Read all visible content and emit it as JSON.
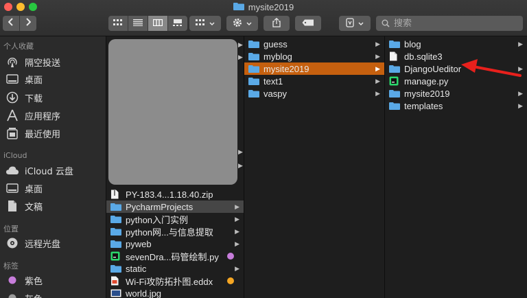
{
  "window": {
    "title": "mysite2019"
  },
  "toolbar": {
    "back_icon": "chevron-left-icon",
    "forward_icon": "chevron-right-icon",
    "view_icons": [
      "icon-view",
      "list-view",
      "column-view",
      "gallery-view"
    ],
    "group_icon": "group-grid-icon",
    "action_icon": "gear-icon",
    "share_icon": "share-icon",
    "tag_icon": "tag-icon",
    "extra_icon": "app-icon",
    "search_placeholder": "搜索"
  },
  "sidebar": {
    "sections": [
      {
        "label": "个人收藏",
        "items": [
          {
            "label": "隔空投送",
            "icon": "airdrop-icon"
          },
          {
            "label": "桌面",
            "icon": "desktop-icon"
          },
          {
            "label": "下载",
            "icon": "download-icon"
          },
          {
            "label": "应用程序",
            "icon": "applications-icon"
          },
          {
            "label": "最近使用",
            "icon": "recents-icon"
          }
        ]
      },
      {
        "label": "iCloud",
        "items": [
          {
            "label": "iCloud 云盘",
            "icon": "cloud-icon"
          },
          {
            "label": "桌面",
            "icon": "desktop-icon"
          },
          {
            "label": "文稿",
            "icon": "document-icon"
          }
        ]
      },
      {
        "label": "位置",
        "items": [
          {
            "label": "远程光盘",
            "icon": "disc-icon"
          }
        ]
      },
      {
        "label": "标签",
        "items": [
          {
            "label": "紫色",
            "icon": "tag-dot-icon",
            "color": "#c77ddb"
          },
          {
            "label": "灰色",
            "icon": "tag-dot-icon",
            "color": "#9a9a9a"
          }
        ]
      }
    ]
  },
  "column1": {
    "items": [
      {
        "label": "PY-183.4...1.18.40.zip",
        "icon": "zip-icon"
      },
      {
        "label": "PycharmProjects",
        "icon": "folder-icon",
        "has_children": true,
        "highlight": true
      },
      {
        "label": "python入门实例",
        "icon": "folder-icon",
        "has_children": true
      },
      {
        "label": "python网...与信息提取",
        "icon": "folder-icon",
        "has_children": true
      },
      {
        "label": "pyweb",
        "icon": "folder-icon",
        "has_children": true
      },
      {
        "label": "sevenDra...码管绘制.py",
        "icon": "python-file-icon",
        "tag_color": "#c77ddb"
      },
      {
        "label": "static",
        "icon": "folder-icon",
        "has_children": true
      },
      {
        "label": "Wi-Fi攻防拓扑图.eddx",
        "icon": "eddx-file-icon",
        "tag_color": "#f5a623"
      },
      {
        "label": "world.jpg",
        "icon": "image-file-icon"
      }
    ]
  },
  "column2": {
    "items": [
      {
        "label": "guess",
        "icon": "folder-icon",
        "has_children": true
      },
      {
        "label": "myblog",
        "icon": "folder-icon",
        "has_children": true
      },
      {
        "label": "mysite2019",
        "icon": "folder-icon",
        "has_children": true,
        "selected": true
      },
      {
        "label": "text1",
        "icon": "folder-icon",
        "has_children": true
      },
      {
        "label": "vaspy",
        "icon": "folder-icon",
        "has_children": true
      }
    ]
  },
  "column3": {
    "items": [
      {
        "label": "blog",
        "icon": "folder-icon",
        "has_children": true
      },
      {
        "label": "db.sqlite3",
        "icon": "blank-file-icon"
      },
      {
        "label": "DjangoUeditor",
        "icon": "folder-icon",
        "has_children": true
      },
      {
        "label": "manage.py",
        "icon": "python-file-icon"
      },
      {
        "label": "mysite2019",
        "icon": "folder-icon",
        "has_children": true
      },
      {
        "label": "templates",
        "icon": "folder-icon",
        "has_children": true
      }
    ]
  },
  "annotation": {
    "icon": "red-arrow-icon",
    "color": "#e8201c"
  },
  "colors": {
    "selection": "#c5600f",
    "folder": "#5aa9e6"
  }
}
